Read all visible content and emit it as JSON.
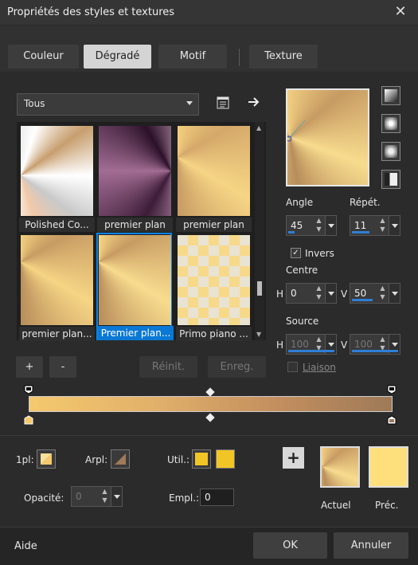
{
  "window": {
    "title": "Propriétés des styles et textures"
  },
  "tabs": [
    {
      "label": "Couleur"
    },
    {
      "label": "Dégradé"
    },
    {
      "label": "Motif"
    },
    {
      "label": "Texture"
    }
  ],
  "filter": {
    "selected": "Tous"
  },
  "gallery": {
    "items": [
      {
        "label": "Polished Co..."
      },
      {
        "label": "premier plan"
      },
      {
        "label": "premier plan"
      },
      {
        "label": "premier plan..."
      },
      {
        "label": "Premier plan..."
      },
      {
        "label": "Primo piano ..."
      }
    ]
  },
  "gallery_buttons": {
    "add": "+",
    "remove": "-",
    "reset": "Réinit.",
    "save": "Enreg."
  },
  "params": {
    "angle_label": "Angle",
    "angle": "45",
    "repeat_label": "Répét.",
    "repeat": "11",
    "invert_label": "Invers",
    "center_label": "Centre",
    "center_h_label": "H",
    "center_h": "0",
    "center_v_label": "V",
    "center_v": "50",
    "source_label": "Source",
    "source_h_label": "H",
    "source_h": "100",
    "source_v_label": "V",
    "source_v": "100",
    "link_label": "Liaison"
  },
  "bottom": {
    "fg_label": "1pl:",
    "bg_label": "Arpl:",
    "use_label": "Util.:",
    "opacity_label": "Opacité:",
    "opacity": "0",
    "location_label": "Empl.:",
    "location": "0",
    "add_symbol": "+",
    "current_label": "Actuel",
    "previous_label": "Préc."
  },
  "footer": {
    "help": "Aide",
    "ok": "OK",
    "cancel": "Annuler"
  },
  "colors": {
    "accent": "#0a78d4",
    "gold": "#f5c96e",
    "brown": "#9e7a58",
    "yellow": "#f2c526"
  }
}
